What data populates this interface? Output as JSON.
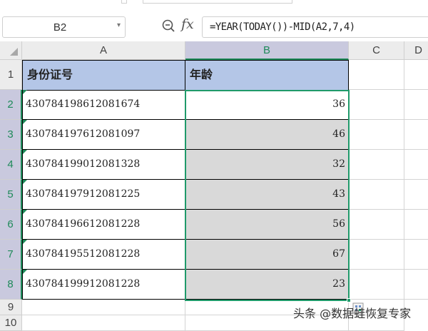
{
  "formula_bar": {
    "name_box": "B2",
    "formula": "=YEAR(TODAY())-MID(A2,7,4)"
  },
  "columns": [
    "A",
    "B",
    "C",
    "D"
  ],
  "rows": [
    "1",
    "2",
    "3",
    "4",
    "5",
    "6",
    "7",
    "8",
    "9",
    "10"
  ],
  "table": {
    "headers": [
      "身份证号",
      "年龄"
    ],
    "rows": [
      {
        "id": "430784198612081674",
        "age": "36"
      },
      {
        "id": "430784197612081097",
        "age": "46"
      },
      {
        "id": "430784199012081328",
        "age": "32"
      },
      {
        "id": "430784197912081225",
        "age": "43"
      },
      {
        "id": "430784196612081228",
        "age": "56"
      },
      {
        "id": "430784195512081228",
        "age": "67"
      },
      {
        "id": "430784199912081228",
        "age": "23"
      }
    ]
  },
  "watermark": "头条 @数据蛙恢复专家",
  "colors": {
    "header_fill": "#b4c6e7",
    "selection": "#1f9a6a",
    "selected_fill": "#d9d9d9"
  }
}
